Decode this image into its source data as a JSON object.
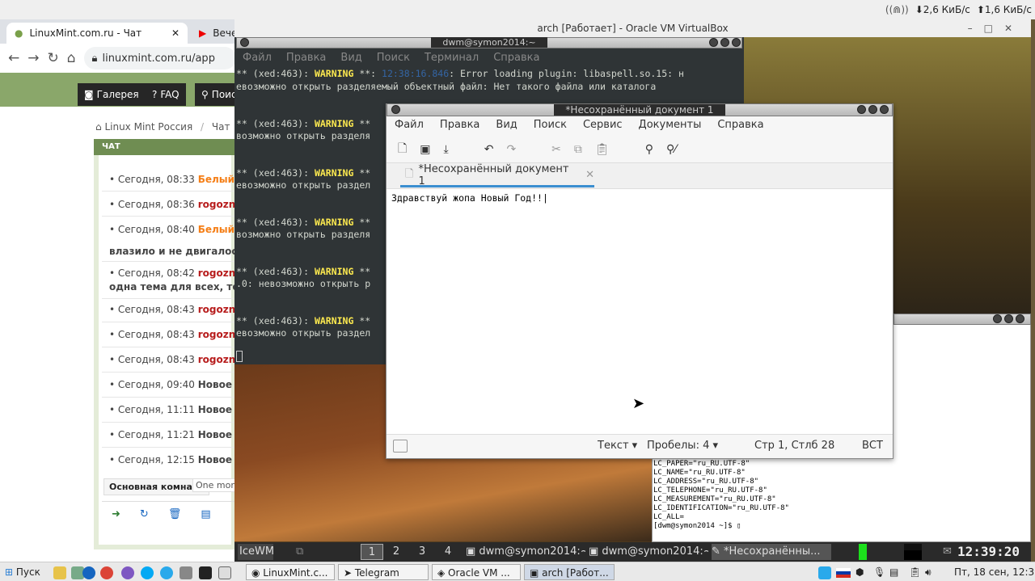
{
  "tray": {
    "net_down": "2,6 КиБ/с",
    "net_up": "1,6 КиБ/с"
  },
  "chrome": {
    "tab1": "LinuxMint.com.ru - Чат",
    "tab2": "Вечер",
    "url": "linuxmint.com.ru/app"
  },
  "site": {
    "nav": [
      "Галерея",
      "FAQ",
      "Поис"
    ],
    "breadcrumb_home": "Linux Mint Россия",
    "breadcrumb_sep": "/",
    "breadcrumb_chat": "Чат",
    "chat_header": "ЧАТ",
    "messages": [
      {
        "time": "Сегодня, 08:33",
        "user": "Белый К"
      },
      {
        "time": "Сегодня, 08:36",
        "user": "rogoznik"
      },
      {
        "time": "Сегодня, 08:40",
        "user": "Белый К"
      },
      {
        "text": "влазило и не двигалось т"
      },
      {
        "time": "Сегодня, 08:42",
        "user": "rogoznik"
      },
      {
        "text": "одна тема для всех, тогда"
      },
      {
        "time": "Сегодня, 08:43",
        "user": "rogoznik"
      },
      {
        "time": "Сегодня, 08:43",
        "user": "rogoznik"
      },
      {
        "time": "Сегодня, 08:43",
        "user": "rogoznik"
      },
      {
        "time": "Сегодня, 09:40",
        "user": "Новое соо"
      },
      {
        "time": "Сегодня, 11:11",
        "user": "Новое соо"
      },
      {
        "time": "Сегодня, 11:21",
        "user": "Новое соо"
      },
      {
        "time": "Сегодня, 12:15",
        "user": "Новое соо"
      }
    ],
    "room_tab": "Основная комната",
    "room_more": "One more"
  },
  "vbox": {
    "title": "arch [Работает] - Oracle VM VirtualBox"
  },
  "term1": {
    "title": "dwm@symon2014:~",
    "menu": [
      "Файл",
      "Правка",
      "Вид",
      "Поиск",
      "Терминал",
      "Справка"
    ],
    "lines": [
      {
        "pre": "** (xed:463): ",
        "warn": "WARNING",
        "mid": " **: ",
        "ts": "12:38:16.846",
        "post": ": Error loading plugin: libaspell.so.15: н"
      },
      {
        "pre": "евозможно открыть разделяемый объектный файл: Нет такого файла или каталога"
      },
      {
        "pre": "** (xed:463): ",
        "warn": "WARNING",
        "mid": " **"
      },
      {
        "pre": "возможно открыть разделя"
      },
      {
        "pre": "** (xed:463): ",
        "warn": "WARNING",
        "mid": " **"
      },
      {
        "pre": "евозможно открыть раздел"
      },
      {
        "pre": "** (xed:463): ",
        "warn": "WARNING",
        "mid": " **"
      },
      {
        "pre": "возможно открыть разделя"
      },
      {
        "pre": "** (xed:463): ",
        "warn": "WARNING",
        "mid": " **"
      },
      {
        "pre": ".0: невозможно открыть р"
      },
      {
        "pre": "** (xed:463): ",
        "warn": "WARNING",
        "mid": " **"
      },
      {
        "pre": "евозможно открыть раздел"
      }
    ]
  },
  "xed": {
    "title": "*Несохранённый документ 1",
    "menu": [
      "Файл",
      "Правка",
      "Вид",
      "Поиск",
      "Сервис",
      "Документы",
      "Справка"
    ],
    "tab": "*Несохранённый документ 1",
    "content": "Здравствуй жопа Новый Год!!",
    "status_lang": "Текст",
    "status_spaces": "Пробелы: 4",
    "status_pos": "Стр 1, Стлб 28",
    "status_mode": "ВСТ"
  },
  "term2": {
    "lines": [
      "LC_PAPER=\"ru_RU.UTF-8\"",
      "LC_NAME=\"ru_RU.UTF-8\"",
      "LC_ADDRESS=\"ru_RU.UTF-8\"",
      "LC_TELEPHONE=\"ru_RU.UTF-8\"",
      "LC_MEASUREMENT=\"ru_RU.UTF-8\"",
      "LC_IDENTIFICATION=\"ru_RU.UTF-8\"",
      "LC_ALL=",
      "[dwm@symon2014 ~]$ "
    ]
  },
  "icewm": {
    "start": "IceWM",
    "workspaces": [
      "1",
      "2",
      "3",
      "4"
    ],
    "tasks": [
      "dwm@symon2014:~",
      "dwm@symon2014:~",
      "*Несохранённы..."
    ],
    "clock": "12:39:20"
  },
  "host": {
    "start": "Пуск",
    "tasks": [
      "LinuxMint.c...",
      "Telegram",
      "Oracle VM ...",
      "arch [Работ..."
    ],
    "clock": "Пт, 18 сен, 12:39"
  }
}
